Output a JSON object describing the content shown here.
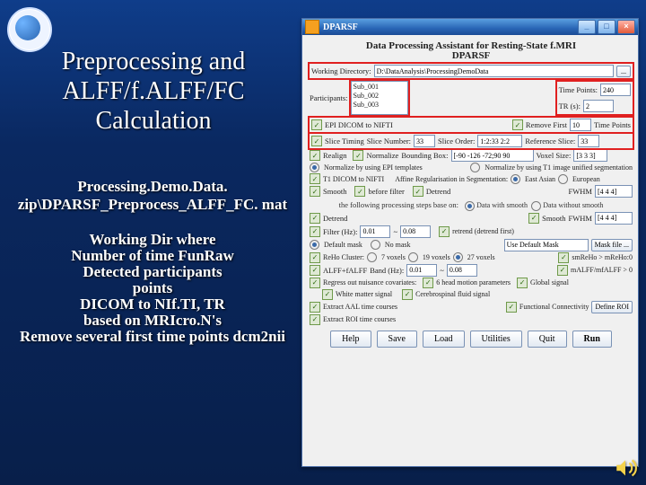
{
  "slide": {
    "title": "Preprocessing and ALFF/f.ALFF/FC Calculation",
    "file": "Processing.Demo.Data. zip\\DPARSF_Preprocess_ALFF_FC. mat",
    "notes_l1": "Working Dir where",
    "notes_l2": "Number of time",
    "notes_l3": "FunRaw",
    "notes_l4": "Detected participants",
    "notes_l5": "points",
    "notes_l6": "DICOM to NIf.TI,",
    "notes_l6b": "TR",
    "notes_l7": "based on MRIcro.N's",
    "notes_l8": "Remove several first time points",
    "notes_l8b": "dcm2nii"
  },
  "gui": {
    "title": "DPARSF",
    "h1": "Data Processing Assistant for Resting-State f.MRI",
    "h2": "DPARSF",
    "wd_label": "Working Directory:",
    "wd_value": "D:\\DataAnalysis\\ProcessingDemoData",
    "wd_browse": "...",
    "participants_label": "Participants:",
    "participants": [
      "Sub_001",
      "Sub_002",
      "Sub_003"
    ],
    "tp_label": "Time Points:",
    "tp_value": "240",
    "tr_label": "TR (s):",
    "tr_value": "2",
    "epi2nifti": "EPI DICOM to NIFTI",
    "removefirst": "Remove First",
    "removefirst_val": "10",
    "removefirst_tail": "Time Points",
    "slicetiming": "Slice Timing",
    "slicenum_label": "Slice Number:",
    "slicenum_val": "33",
    "sliceorder_label": "Slice Order:",
    "sliceorder_val": "1:2:33 2:2",
    "refslice_label": "Reference Slice:",
    "refslice_val": "33",
    "realign": "Realign",
    "normalize": "Normalize",
    "bbox_label": "Bounding Box:",
    "bbox_val": "[-90 -126 -72;90 90",
    "voxsize_label": "Voxel Size:",
    "voxsize_val": "[3 3 3]",
    "norm_epi": "Normalize by using EPI templates",
    "norm_t1": "Normalize by using T1 image unified segmentation",
    "t1dicom": "T1 DICOM to NIFTI",
    "affine_label": "Affine Regularisation in Segmentation:",
    "affine_east": "East Asian",
    "affine_euro": "European",
    "smooth": "Smooth",
    "smooth_detrend": "before filter",
    "detrend": "Detrend",
    "detrend2": "Smooth",
    "fwhm_label": "FWHM",
    "fwhm_val": "[4 4 4]",
    "sep": "the following processing steps base on:",
    "sep_a": "Data with smooth",
    "sep_b": "Data without smooth",
    "filter": "Filter (Hz):",
    "filter_lo": "0.01",
    "filter_hi": "0.08",
    "filter_tail": "retrend (detrend first)",
    "defmask": "Default mask",
    "nomask": "No mask",
    "usermask_val": "",
    "usermask_btn": "Use Default Mask",
    "mask_browse": "Mask file ...",
    "reho_cluster": "ReHo  Cluster:",
    "reho_7": "7 voxels",
    "reho_19": "19 voxels",
    "reho_27": "27 voxels",
    "reho_tail": "smReHo > mReHo:0",
    "alff": "ALFF+fALFF",
    "band_label": "Band (Hz):",
    "band_lo": "0.01",
    "band_hi": "0.08",
    "alff_tail": "mALFF/mfALFF > 0",
    "regress": "Regress out nuisance covariates:",
    "headmot": "6 head motion parameters",
    "gs": "Global signal",
    "wm": "White matter signal",
    "csf": "Cerebrospinal fluid signal",
    "aal": "Extract AAL time courses",
    "fc": "Functional Connectivity",
    "defroi": "Define ROI",
    "remroi": "Extract ROI time courses",
    "b_help": "Help",
    "b_save": "Save",
    "b_load": "Load",
    "b_util": "Utilities",
    "b_quit": "Quit",
    "b_run": "Run"
  }
}
